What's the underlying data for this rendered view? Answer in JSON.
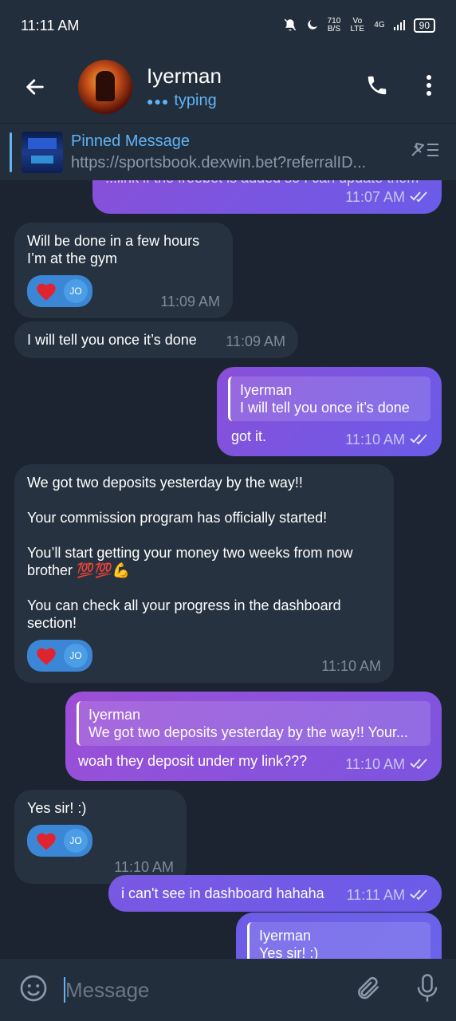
{
  "status_bar": {
    "time": "11:11 AM",
    "net_speed": "710",
    "net_unit": "B/S",
    "carrier": "Vo LTE",
    "network": "4G",
    "battery": "90"
  },
  "header": {
    "name": "Iyerman",
    "status": "typing"
  },
  "pinned": {
    "title": "Pinned Message",
    "text": "https://sportsbook.dexwin.bet?referralID..."
  },
  "messages": [
    {
      "text": "...link if the freebet is added so I can update them",
      "time": "11:07 AM"
    },
    {
      "text_line1": "Will be done in a few hours",
      "text_line2": "I’m at the gym",
      "time": "11:09 AM",
      "reaction": "JO"
    },
    {
      "text": "I will tell you once it’s done",
      "time": "11:09 AM"
    },
    {
      "quote_name": "Iyerman",
      "quote_text": "I will tell you once it’s done",
      "text": "got it.",
      "time": "11:10 AM"
    },
    {
      "p1": "We got two deposits yesterday by the way!!",
      "p2": "Your commission program has officially started!",
      "p3a": "You’ll start getting your money two weeks from now",
      "p3b": "brother 💯💯💪",
      "p4a": "You can check all your progress in the dashboard",
      "p4b": "section!",
      "time": "11:10 AM",
      "reaction": "JO"
    },
    {
      "quote_name": "Iyerman",
      "quote_text": "We got two deposits yesterday by the way!!  Your...",
      "text": "woah they deposit under my link???",
      "time": "11:10 AM"
    },
    {
      "text": "Yes sir! :)",
      "time": "11:10 AM",
      "reaction": "JO"
    },
    {
      "text": "i can't see in dashboard hahaha",
      "time": "11:11 AM"
    },
    {
      "quote_name": "Iyerman",
      "quote_text": "Yes sir! :)"
    }
  ],
  "input": {
    "placeholder": "Message"
  },
  "colors": {
    "accent": "#5eb5f7",
    "outgoing": "#8a4fd8",
    "incoming": "#263240"
  }
}
